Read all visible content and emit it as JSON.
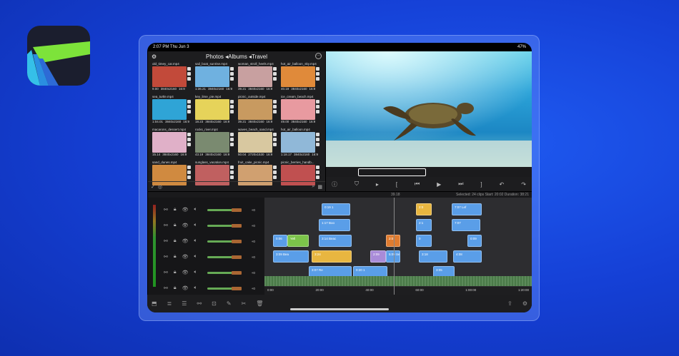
{
  "app": {
    "name": "LumaFusion"
  },
  "status": {
    "time": "2:07 PM",
    "date": "Thu Jun 3",
    "battery": "47%"
  },
  "browser": {
    "title": "Photos ◂Albums ◂Travel",
    "clips": [
      {
        "name": "old_timey_car.mp4",
        "dur": "9.00",
        "res": "3840x2160",
        "ratio": "16:9",
        "color": "#c24a3a"
      },
      {
        "name": "sail_boat_sunrise.mp4",
        "dur": "1:36.21",
        "res": "3840x2160",
        "ratio": "16:9",
        "color": "#6fb1e0"
      },
      {
        "name": "woman_stroll_heels.mp4",
        "dur": "39.21",
        "res": "3840x2160",
        "ratio": "16:9",
        "color": "#c8a0a0"
      },
      {
        "name": "hot_air_balloon_sky.mp4",
        "dur": "40.19",
        "res": "3840x2160",
        "ratio": "16:9",
        "color": "#e08a3a"
      },
      {
        "name": "sea_turtle.mp4",
        "dur": "1:04.01",
        "res": "3840x2160",
        "ratio": "16:9",
        "color": "#2fa4d6"
      },
      {
        "name": "key_lime_pie.mp4",
        "dur": "18.23",
        "res": "3840x2160",
        "ratio": "16:9",
        "color": "#e6d35a"
      },
      {
        "name": "picnic_outside.mp4",
        "dur": "39.21",
        "res": "3840x2160",
        "ratio": "16:9",
        "color": "#c89a60"
      },
      {
        "name": "ice_cream_beach.mp4",
        "dur": "49.00",
        "res": "3840x2160",
        "ratio": "16:9",
        "color": "#e89aa0"
      },
      {
        "name": "macarons_dessert.mp4",
        "dur": "15.14",
        "res": "3840x2160",
        "ratio": "16:9",
        "color": "#e0b0c8"
      },
      {
        "name": "rocks_river.mp4",
        "dur": "43.19",
        "res": "3840x2160",
        "ratio": "16:9",
        "color": "#7a8a70"
      },
      {
        "name": "waves_beach_sand.mp4",
        "dur": "50.04",
        "res": "2720x1530",
        "ratio": "16:9",
        "color": "#d8c8a0"
      },
      {
        "name": "hot_air_balloon.mp4",
        "dur": "1:18.17",
        "res": "3840x2160",
        "ratio": "16:9",
        "color": "#90b8d8"
      },
      {
        "name": "sand_dunes.mp4",
        "dur": "",
        "res": "",
        "ratio": "",
        "color": "#d08a40"
      },
      {
        "name": "sunglass_vacation.mp4",
        "dur": "",
        "res": "",
        "ratio": "",
        "color": "#c06060"
      },
      {
        "name": "fruit_cake_picnic.mp4",
        "dur": "",
        "res": "",
        "ratio": "",
        "color": "#d0a070"
      },
      {
        "name": "picnic_berries_handb...",
        "dur": "",
        "res": "",
        "ratio": "",
        "color": "#c05050"
      }
    ]
  },
  "timeline": {
    "timecode": "39.18",
    "selection_info": "Selected: 24 clips Start: 20:02 Duration: 38:21",
    "db": "+0",
    "ruler": [
      "0:00",
      "20:00",
      "40:00",
      "60:00",
      "1:00:00",
      "1:20:00"
    ],
    "clips": [
      {
        "label": "0:19 1",
        "color": "blue"
      },
      {
        "label": "2:0",
        "color": "yel"
      },
      {
        "label": "7:07 Lef",
        "color": "blue"
      },
      {
        "label": "1:17 Boo",
        "color": "blue"
      },
      {
        "label": "2:1",
        "color": "blue"
      },
      {
        "label": "7:07",
        "color": "blue"
      },
      {
        "label": "0:06",
        "color": "blue"
      },
      {
        "label": "Yell",
        "color": "grn"
      },
      {
        "label": "3:14 Beac",
        "color": "blue"
      },
      {
        "label": "2:0",
        "color": "org"
      },
      {
        "label": "0",
        "color": "blue"
      },
      {
        "label": "0:09",
        "color": "blue"
      },
      {
        "label": "3:09 Bea",
        "color": "blue"
      },
      {
        "label": "3:24",
        "color": "yel"
      },
      {
        "label": "2:09",
        "color": "pur"
      },
      {
        "label": "5:09 Sea",
        "color": "blue"
      },
      {
        "label": "3:18",
        "color": "blue"
      },
      {
        "label": "4:08",
        "color": "blue"
      },
      {
        "label": "3:07 Re",
        "color": "blue"
      },
      {
        "label": "0:20 1",
        "color": "blue"
      },
      {
        "label": "3:05",
        "color": "blue"
      }
    ]
  }
}
